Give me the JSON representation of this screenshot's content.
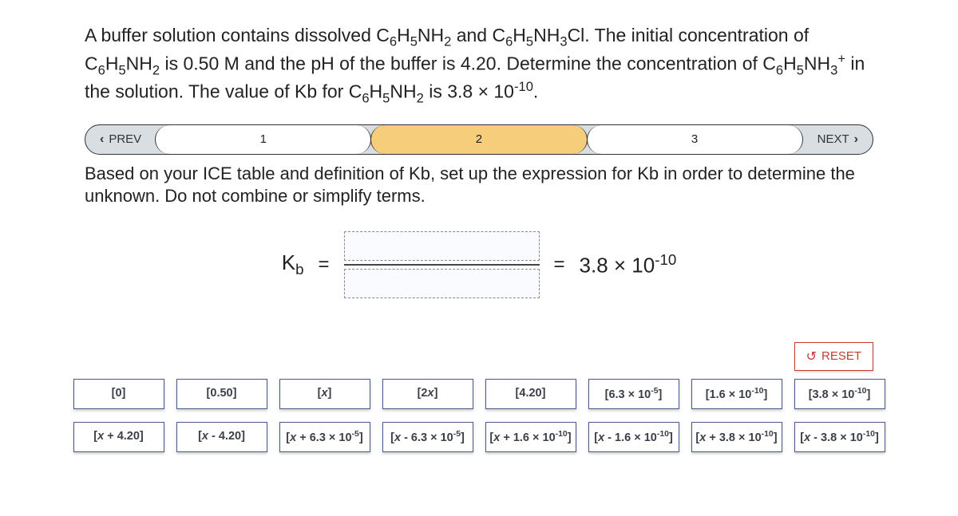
{
  "question": {
    "html": "A buffer solution contains dissolved C<sub>6</sub>H<sub>5</sub>NH<sub>2</sub> and C<sub>6</sub>H<sub>5</sub>NH<sub>3</sub>Cl. The initial concentration of C<sub>6</sub>H<sub>5</sub>NH<sub>2</sub> is 0.50 M and the pH of the buffer is 4.20. Determine the concentration of C<sub>6</sub>H<sub>5</sub>NH<sub>3</sub><sup>+</sup> in the solution. The value of Kb for C<sub>6</sub>H<sub>5</sub>NH<sub>2</sub> is 3.8 × 10<sup>-10</sup>."
  },
  "nav": {
    "prev": "PREV",
    "next": "NEXT",
    "steps": [
      "1",
      "2",
      "3"
    ],
    "active_index": 1
  },
  "instruction": "Based on your ICE table and definition of Kb, set up the expression for Kb in order to determine the unknown. Do not combine or simplify terms.",
  "equation": {
    "label_html": "K<sub>b</sub>",
    "eq1": "=",
    "eq2": "=",
    "result_html": "3.8 × 10<sup>-10</sup>"
  },
  "reset_label": "RESET",
  "tiles_row1": [
    "[0]",
    "[0.50]",
    "[<i>x</i>]",
    "[2<i>x</i>]",
    "[4.20]",
    "[6.3 × 10<sup>-5</sup>]",
    "[1.6 × 10<sup>-10</sup>]",
    "[3.8 × 10<sup>-10</sup>]"
  ],
  "tiles_row2": [
    "[<i>x</i> + 4.20]",
    "[<i>x</i> - 4.20]",
    "[<i>x</i> + 6.3 × 10<sup>-5</sup>]",
    "[<i>x</i> - 6.3 × 10<sup>-5</sup>]",
    "[<i>x</i> + 1.6 × 10<sup>-10</sup>]",
    "[<i>x</i> - 1.6 × 10<sup>-10</sup>]",
    "[<i>x</i> + 3.8 × 10<sup>-10</sup>]",
    "[<i>x</i> - 3.8 × 10<sup>-10</sup>]"
  ]
}
